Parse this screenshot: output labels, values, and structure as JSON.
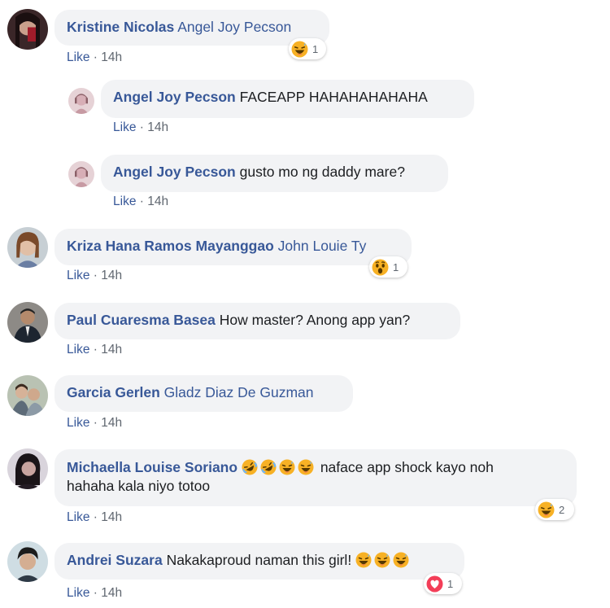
{
  "comments": [
    {
      "author": "Kristine Nicolas",
      "tag": "Angel Joy Pecson",
      "text": "",
      "like": "Like",
      "sep": " · ",
      "time": "14h",
      "reaction": {
        "icon": "haha-reaction-icon",
        "count": "1"
      }
    },
    {
      "author": "Angel Joy Pecson",
      "text": "FACEAPP HAHAHAHAHAHA",
      "like": "Like",
      "sep": " · ",
      "time": "14h"
    },
    {
      "author": "Angel Joy Pecson",
      "text": "gusto mo ng daddy mare?",
      "like": "Like",
      "sep": " · ",
      "time": "14h"
    },
    {
      "author": "Kriza Hana Ramos Mayanggao",
      "tag": "John Louie Ty",
      "like": "Like",
      "sep": " · ",
      "time": "14h",
      "reaction": {
        "icon": "wow-reaction-icon",
        "count": "1"
      }
    },
    {
      "author": "Paul Cuaresma Basea",
      "text": "How master? Anong app yan?",
      "like": "Like",
      "sep": " · ",
      "time": "14h"
    },
    {
      "author": "Garcia Gerlen",
      "tag": "Gladz Diaz De Guzman",
      "like": "Like",
      "sep": " · ",
      "time": "14h"
    },
    {
      "author": "Michaella Louise Soriano",
      "emojis": [
        "rofl-emoji",
        "rofl-emoji",
        "grin-sweat-emoji",
        "grin-sweat-emoji"
      ],
      "text_line1": "naface app shock kayo noh",
      "text_line2": "hahaha kala niyo totoo",
      "like": "Like",
      "sep": " · ",
      "time": "14h",
      "reaction": {
        "icon": "haha-reaction-icon",
        "count": "2"
      }
    },
    {
      "author": "Andrei Suzara",
      "text": "Nakakaproud naman this girl!",
      "emojis": [
        "grin-sweat-emoji",
        "grin-sweat-emoji",
        "grin-sweat-emoji"
      ],
      "like": "Like",
      "sep": " · ",
      "time": "14h",
      "reaction": {
        "icon": "love-reaction-icon",
        "count": "1"
      }
    }
  ],
  "colors": {
    "link": "#385898",
    "bubble": "#f2f3f5",
    "meta": "#606770",
    "love": "#f33e58",
    "haha": "#f7b125"
  }
}
